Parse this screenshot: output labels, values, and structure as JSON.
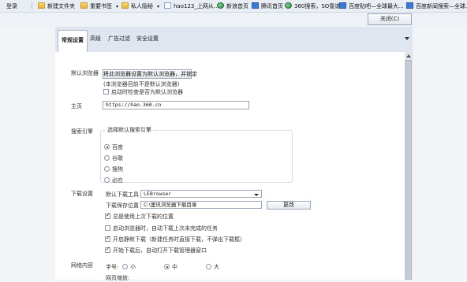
{
  "bookmarks": [
    {
      "label": "登录",
      "icon": "none"
    },
    {
      "label": "新建文件夹",
      "icon": "folder-icon"
    },
    {
      "label": "重要书签",
      "icon": "folder-icon"
    },
    {
      "label": "私人隐秘",
      "icon": "folder-icon"
    },
    {
      "label": "hao123_上网从...",
      "icon": "page-icon"
    },
    {
      "label": "新浪首页",
      "icon": "page-icon"
    },
    {
      "label": "腾讯首页",
      "icon": "page-icon"
    },
    {
      "label": "360搜索，SO靠谱",
      "icon": "globe-icon"
    },
    {
      "label": "百度贴吧—全球最大...",
      "icon": "page-icon"
    },
    {
      "label": "百度新闻搜索—全球...",
      "icon": "page-icon"
    }
  ],
  "window": {
    "close_label": "关闭(C)"
  },
  "tabs": [
    {
      "label": "常规设置",
      "active": true
    },
    {
      "label": "高级",
      "active": false
    },
    {
      "label": "广告过滤",
      "active": false
    },
    {
      "label": "安全设置",
      "active": false
    }
  ],
  "default_browser": {
    "label": "默认浏览器",
    "button": "将此浏览器设置为默认浏览器，并锁定",
    "note": "(本浏览器目前不是默认浏览器)",
    "check_label": "启动时检查是否为默认浏览器",
    "checked": false
  },
  "homepage": {
    "label": "主页",
    "value": "https://hao.360.cn"
  },
  "search": {
    "label": "搜索引擎",
    "group_title": "选择默认搜索引擎",
    "options": [
      "百度",
      "谷歌",
      "搜狗",
      "必应"
    ],
    "selected": "百度"
  },
  "download": {
    "label": "下载设置",
    "tool_label": "默认下载工具",
    "tool_value": "LEBrowser",
    "path_label": "下载保存位置",
    "path_value": "C:\\里讯浏览器下载目录",
    "change_button": "更改",
    "options": [
      {
        "label": "总是使用上次下载的位置",
        "checked": true
      },
      {
        "label": "启动浏览器时，自动下载上次未完成的任务",
        "checked": false
      },
      {
        "label": "开启静默下载（新建任务时直接下载，不弹出下载框）",
        "checked": true
      },
      {
        "label": "开始下载后，自动打开下载管理器窗口",
        "checked": true
      }
    ]
  },
  "web_content": {
    "label": "网络内容",
    "font_label": "字号:",
    "font_options": [
      "小",
      "中",
      "大"
    ],
    "font_selected": "中",
    "zoom_label": "网页缩放:"
  },
  "colors": {
    "accent": "#3b78d8",
    "panel": "#ffffff",
    "chrome": "#dfe6ef"
  }
}
